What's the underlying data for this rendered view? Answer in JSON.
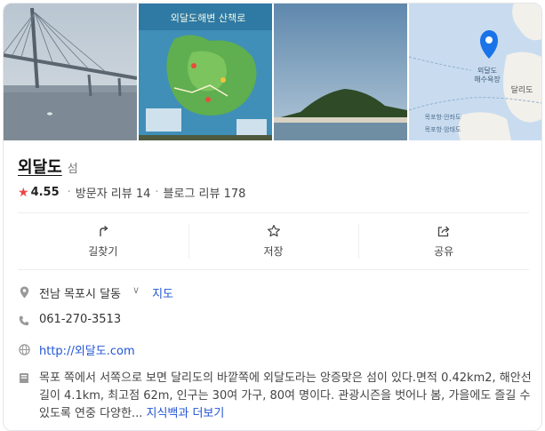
{
  "photos": [
    {
      "name": "bridge-photo"
    },
    {
      "name": "map-board-photo",
      "sign_text": "외달도해변 산책로"
    },
    {
      "name": "island-photo"
    },
    {
      "name": "map-thumbnail",
      "labels": [
        "외달도",
        "해수욕장",
        "달리도",
        "목포항·안좌도",
        "목포항·암태도"
      ]
    }
  ],
  "place": {
    "name": "외달도",
    "category": "섬",
    "rating": "4.55",
    "visitor_reviews": "방문자 리뷰 14",
    "blog_reviews": "블로그 리뷰 178"
  },
  "actions": [
    {
      "label": "길찾기",
      "icon": "directions-icon"
    },
    {
      "label": "저장",
      "icon": "star-outline-icon"
    },
    {
      "label": "공유",
      "icon": "share-icon"
    }
  ],
  "info": {
    "address": "전남 목포시 달동",
    "address_chevron": "∨",
    "map_link": "지도",
    "phone": "061-270-3513",
    "website": "http://외달도.com",
    "description": "목포 쪽에서 서쪽으로 보면 달리도의 바깥쪽에 외달도라는 앙증맞은 섬이 있다.면적 0.42km2, 해안선길이 4.1km, 최고점 62m, 인구는 30여 가구, 80여 명이다. 관광시즌을 벗어나 봄, 가을에도 즐길 수 있도록 연중 다양한...",
    "more_link": "지식백과 더보기"
  },
  "colors": {
    "star": "#ef4444",
    "link": "#2155d4",
    "pin": "#1a73e8"
  }
}
